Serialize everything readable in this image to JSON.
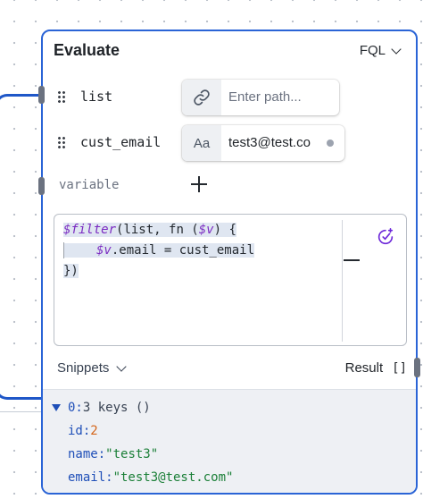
{
  "node": {
    "title": "Evaluate",
    "language": "FQL"
  },
  "inputs": [
    {
      "name": "list",
      "icon": "link-icon",
      "placeholder": "Enter path...",
      "value": ""
    },
    {
      "name": "cust_email",
      "icon": "text-type-icon",
      "icon_text": "Aa",
      "placeholder": "",
      "value": "test3@test.co"
    }
  ],
  "add_variable": {
    "placeholder": "variable"
  },
  "editor": {
    "line1_fn": "$filter",
    "line1_a": "(list, fn (",
    "line1_var": "$v",
    "line1_b": ") {",
    "line2_var": "$v",
    "line2_b": ".email = cust_email",
    "line3": "})"
  },
  "footer": {
    "snippets_label": "Snippets",
    "result_label": "Result",
    "result_icon": "[]"
  },
  "result": {
    "root_key": "0:",
    "root_meta": "3 keys ()",
    "props": [
      {
        "key": "id:",
        "value": "2",
        "kind": "num"
      },
      {
        "key": "name:",
        "value": "\"test3\"",
        "kind": "str"
      },
      {
        "key": "email:",
        "value": "\"test3@test.com\"",
        "kind": "str"
      }
    ]
  },
  "colors": {
    "accent": "#2a64d6",
    "wire": "#1f57c8",
    "fn": "#7b2bc2",
    "number": "#d4651a",
    "string": "#1a7f37"
  }
}
